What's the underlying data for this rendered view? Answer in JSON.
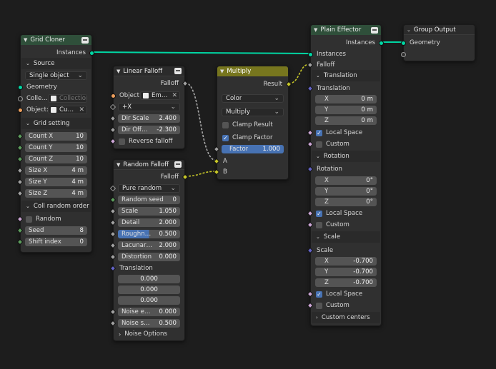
{
  "grid_cloner": {
    "title": "Grid Cloner",
    "output_instances": "Instances",
    "source_section": "Source",
    "source_mode": "Single object",
    "geometry": "Geometry",
    "collection_label": "Colle…",
    "collection_placeholder": "Collection",
    "object_label": "Object:",
    "object_value": "Cu…",
    "grid_section": "Grid setting",
    "count_x_label": "Count X",
    "count_x": "10",
    "count_y_label": "Count Y",
    "count_y": "10",
    "count_z_label": "Count Z",
    "count_z": "10",
    "size_x_label": "Size X",
    "size_x": "4 m",
    "size_y_label": "Size Y",
    "size_y": "4 m",
    "size_z_label": "Size Z",
    "size_z": "4 m",
    "random_section": "Coll random order",
    "random_label": "Random",
    "seed_label": "Seed",
    "seed": "8",
    "shift_label": "Shift index",
    "shift": "0"
  },
  "linear_falloff": {
    "title": "Linear Falloff",
    "output_falloff": "Falloff",
    "object_label": "Object:",
    "object_value": "Em…",
    "axis": "+X",
    "dir_scale_label": "Dir Scale",
    "dir_scale": "2.400",
    "dir_offset_label": "Dir Off…",
    "dir_offset": "-2.300",
    "reverse_label": "Reverse falloff"
  },
  "random_falloff": {
    "title": "Random Falloff",
    "output_falloff": "Falloff",
    "mode": "Pure random",
    "seed_label": "Random seed",
    "seed": "0",
    "scale_label": "Scale",
    "scale": "1.050",
    "detail_label": "Detail",
    "detail": "2.000",
    "rough_label": "Roughn…",
    "rough": "0.500",
    "lacun_label": "Lacunar…",
    "lacun": "2.000",
    "dist_label": "Distortion",
    "dist": "0.000",
    "translation_label": "Translation",
    "t_x": "0.000",
    "t_y": "0.000",
    "t_z": "0.000",
    "noise_e_label": "Noise e…",
    "noise_e": "0.000",
    "noise_s_label": "Noise s…",
    "noise_s": "0.500",
    "noise_options": "Noise Options"
  },
  "multiply": {
    "title": "Multiply",
    "output_result": "Result",
    "type": "Color",
    "op": "Multiply",
    "clamp_result": "Clamp Result",
    "clamp_factor": "Clamp Factor",
    "factor_label": "Factor",
    "factor": "1.000",
    "input_a": "A",
    "input_b": "B"
  },
  "plain_effector": {
    "title": "Plain Effector",
    "output_instances": "Instances",
    "input_instances": "Instances",
    "input_falloff": "Falloff",
    "translation_section": "Translation",
    "translation_label": "Translation",
    "tx_label": "X",
    "tx": "0 m",
    "ty_label": "Y",
    "ty": "0 m",
    "tz_label": "Z",
    "tz": "0 m",
    "local_space": "Local Space",
    "custom": "Custom",
    "rotation_section": "Rotation",
    "rotation_label": "Rotation",
    "rx_label": "X",
    "rx": "0°",
    "ry_label": "Y",
    "ry": "0°",
    "rz_label": "Z",
    "rz": "0°",
    "scale_section": "Scale",
    "scale_label": "Scale",
    "sx_label": "X",
    "sx": "-0.700",
    "sy_label": "Y",
    "sy": "-0.700",
    "sz_label": "Z",
    "sz": "-0.700",
    "custom_centers": "Custom centers"
  },
  "group_output": {
    "title": "Group Output",
    "geometry": "Geometry"
  },
  "colors": {
    "geometry_socket": "#00d6a3",
    "float_socket": "#a1a1a1",
    "color_socket": "#c7c729",
    "accent_blue": "#4772b3",
    "node_green_header": "#2f4f3a",
    "node_olive_header": "#77761e"
  }
}
